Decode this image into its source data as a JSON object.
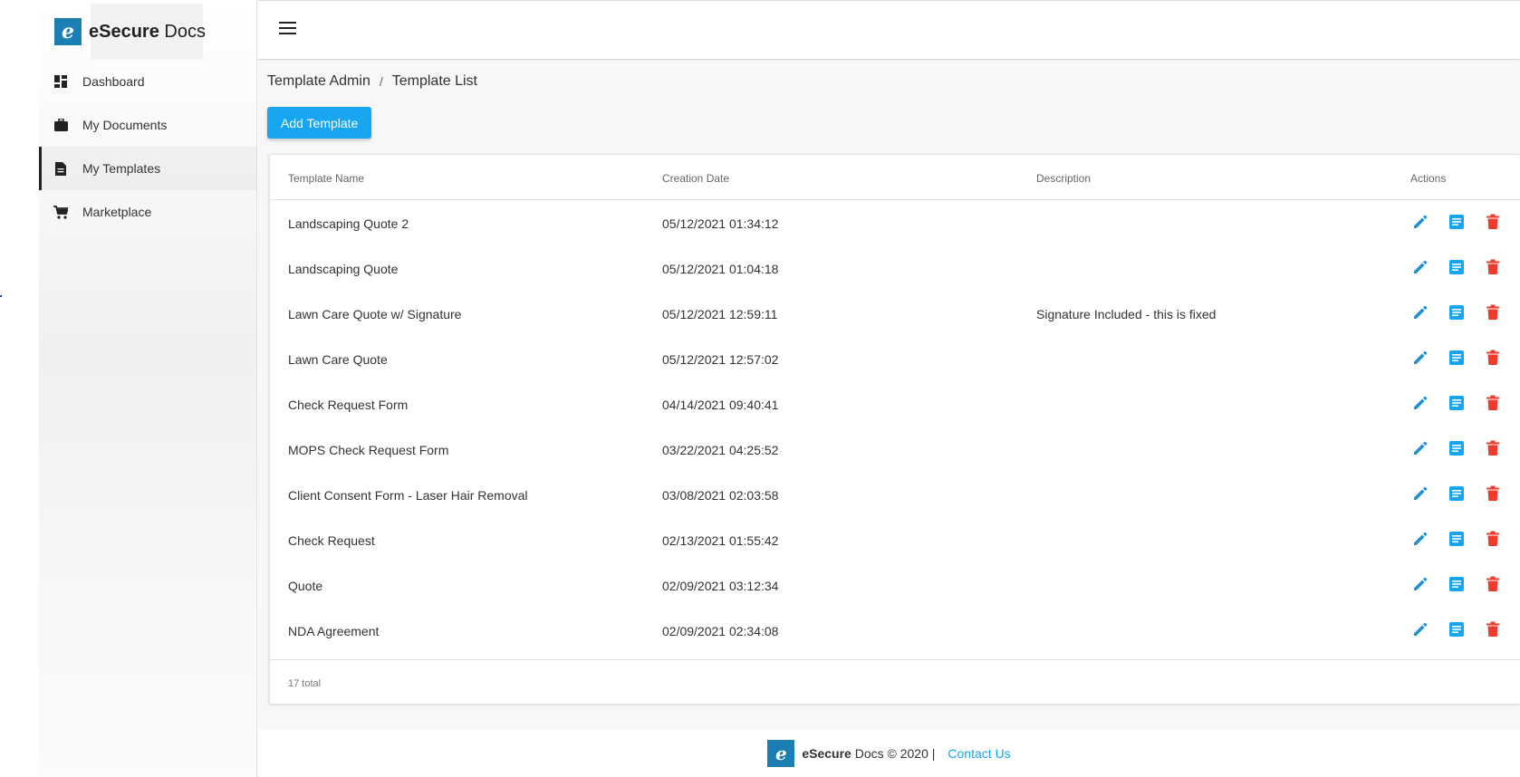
{
  "app": {
    "brand_bold": "eSecure",
    "brand_rest": " Docs",
    "logo_letter": "e",
    "brand_color": "#1c7fb4",
    "accent_color": "#16a5ee",
    "danger_color": "#ef3b2d"
  },
  "sidebar": {
    "items": [
      {
        "label": "Dashboard",
        "icon": "dashboard-icon"
      },
      {
        "label": "My Documents",
        "icon": "briefcase-icon"
      },
      {
        "label": "My Templates",
        "icon": "document-icon",
        "active": true
      },
      {
        "label": "Marketplace",
        "icon": "cart-icon"
      }
    ]
  },
  "topbar": {
    "menu_icon": "hamburger-menu-icon"
  },
  "breadcrumb": {
    "parent": "Template Admin",
    "separator": "/",
    "current": "Template List"
  },
  "toolbar": {
    "add_label": "Add Template"
  },
  "table": {
    "headers": [
      "Template Name",
      "Creation Date",
      "Description",
      "Actions"
    ],
    "rows": [
      {
        "name": "Landscaping Quote 2",
        "date": "05/12/2021 01:34:12",
        "description": ""
      },
      {
        "name": "Landscaping Quote",
        "date": "05/12/2021 01:04:18",
        "description": ""
      },
      {
        "name": "Lawn Care Quote w/ Signature",
        "date": "05/12/2021 12:59:11",
        "description": "Signature Included - this is fixed"
      },
      {
        "name": "Lawn Care Quote",
        "date": "05/12/2021 12:57:02",
        "description": ""
      },
      {
        "name": "Check Request Form",
        "date": "04/14/2021 09:40:41",
        "description": ""
      },
      {
        "name": "MOPS Check Request Form",
        "date": "03/22/2021 04:25:52",
        "description": ""
      },
      {
        "name": "Client Consent Form - Laser Hair Removal",
        "date": "03/08/2021 02:03:58",
        "description": ""
      },
      {
        "name": "Check Request",
        "date": "02/13/2021 01:55:42",
        "description": ""
      },
      {
        "name": "Quote",
        "date": "02/09/2021 03:12:34",
        "description": ""
      },
      {
        "name": "NDA Agreement",
        "date": "02/09/2021 02:34:08",
        "description": ""
      }
    ],
    "action_icons": [
      "edit-pencil-icon",
      "view-document-icon",
      "delete-trash-icon"
    ],
    "total": "17 total"
  },
  "footer": {
    "brand_bold": "eSecure",
    "brand_rest": " Docs © 2020 |",
    "contact": "Contact Us"
  }
}
